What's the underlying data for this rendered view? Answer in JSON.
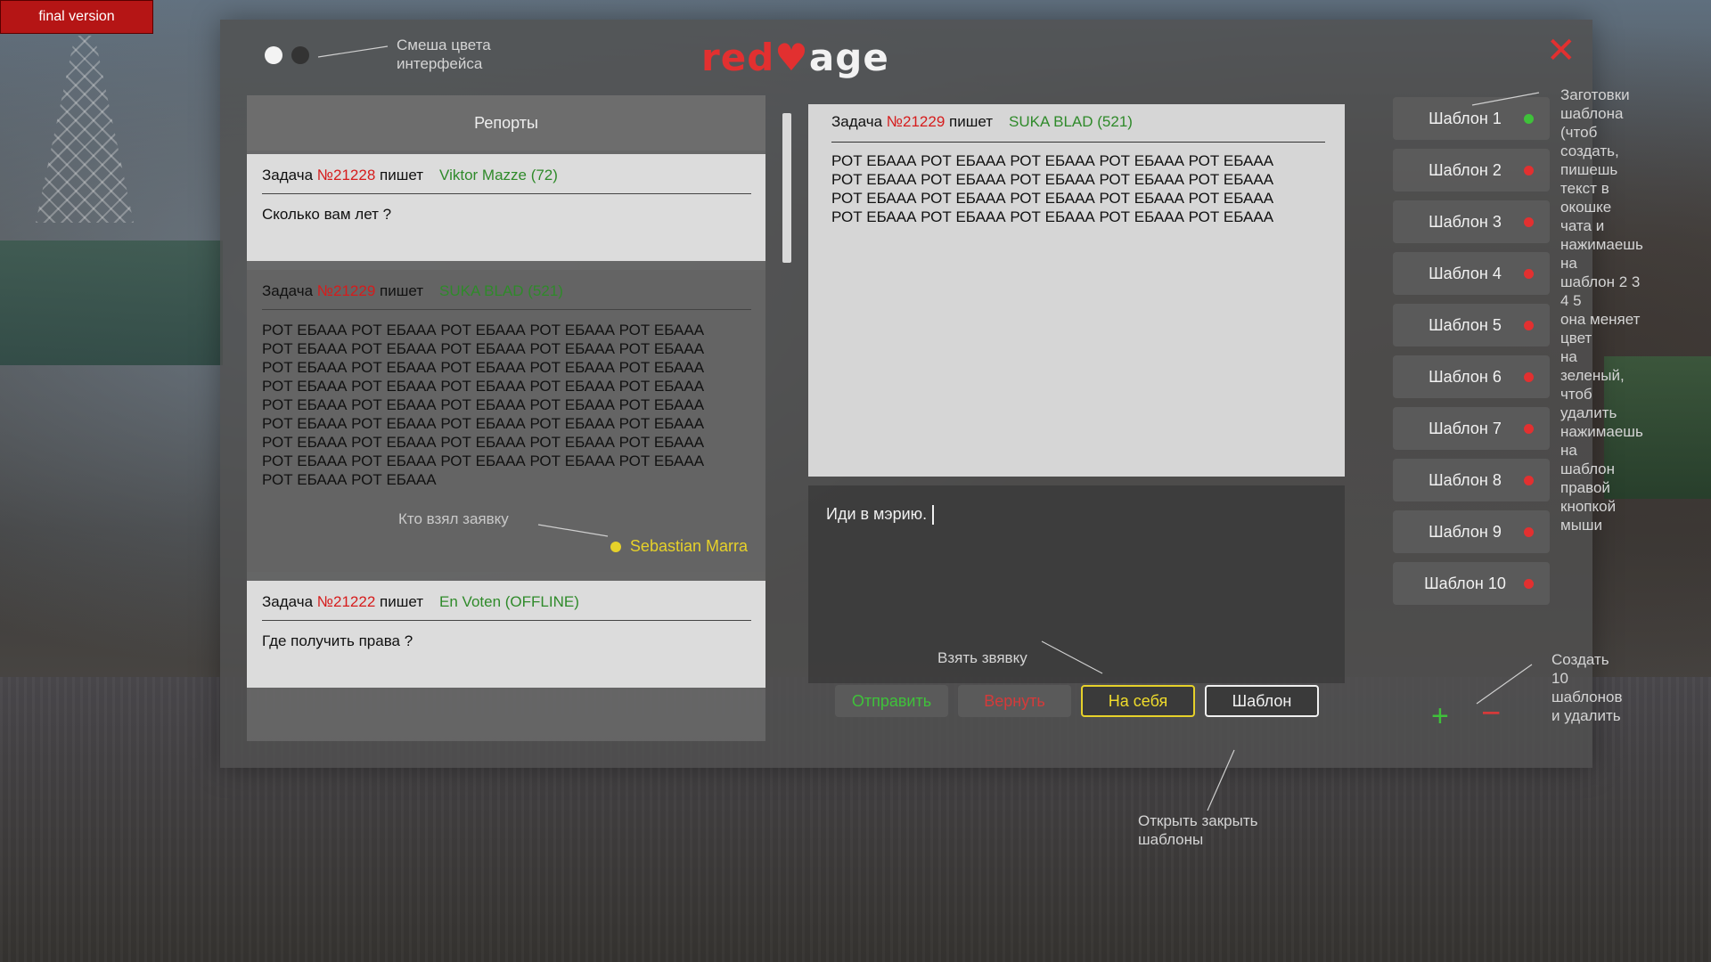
{
  "badge": "final version",
  "logo": {
    "part1": "red",
    "part2": "age"
  },
  "hints": {
    "color_swap": "Смеша цвета\nинтерфейса",
    "templates_info": "Заготовки\nшаблона\n(чтоб создать,\nпишешь текст в\nокошке чата и\nнажимаешь на\nшаблон 2 3 4 5\nона меняет цвет\nна зеленый, чтоб\nудалить\nнажимаешь на\nшаблон правой\nкнопкой мыши",
    "who_took": "Кто взял заявку",
    "take_request": "Взять звявку",
    "open_close_templates": "Открыть закрыть\nшаблоны",
    "create_templates": "Создать 10\nшаблонов\nи удалить"
  },
  "reports": {
    "title": "Репорты",
    "items": [
      {
        "prefix": "Задача ",
        "num": "№21228",
        "verb": " пишет",
        "author": "Viktor Mazze (72)",
        "text": "Сколько вам лет ?"
      },
      {
        "prefix": "Задача ",
        "num": "№21229",
        "verb": " пишет",
        "author": "SUKA BLAD (521)",
        "text": "РОТ ЕБААА РОТ ЕБААА РОТ ЕБААА РОТ ЕБААА РОТ ЕБААА\nРОТ ЕБААА РОТ ЕБААА РОТ ЕБААА РОТ ЕБААА РОТ ЕБААА\nРОТ ЕБААА РОТ ЕБААА РОТ ЕБААА РОТ ЕБААА РОТ ЕБААА\nРОТ ЕБААА РОТ ЕБААА РОТ ЕБААА РОТ ЕБААА РОТ ЕБААА\nРОТ ЕБААА РОТ ЕБААА РОТ ЕБААА РОТ ЕБААА РОТ ЕБААА\nРОТ ЕБААА РОТ ЕБААА РОТ ЕБААА РОТ ЕБААА РОТ ЕБААА\nРОТ ЕБААА РОТ ЕБААА РОТ ЕБААА РОТ ЕБААА РОТ ЕБААА\nРОТ ЕБААА РОТ ЕБААА РОТ ЕБААА РОТ ЕБААА РОТ ЕБААА\nРОТ ЕБААА РОТ ЕБААА",
        "taker": "Sebastian Marra"
      },
      {
        "prefix": "Задача ",
        "num": "№21222",
        "verb": " пишет",
        "author": "En Voten (OFFLINE)",
        "text": "Где получить права ?"
      }
    ]
  },
  "chat": {
    "prefix": "Задача ",
    "num": "№21229",
    "verb": " пишет",
    "author": "SUKA BLAD (521)",
    "text": "РОТ ЕБААА РОТ ЕБААА РОТ ЕБААА РОТ ЕБААА РОТ ЕБААА\nРОТ ЕБААА РОТ ЕБААА РОТ ЕБААА РОТ ЕБААА РОТ ЕБААА\nРОТ ЕБААА РОТ ЕБААА РОТ ЕБААА РОТ ЕБААА РОТ ЕБААА\nРОТ ЕБААА РОТ ЕБААА РОТ ЕБААА РОТ ЕБААА РОТ ЕБААА",
    "input_value": "Иди в мэрию."
  },
  "buttons": {
    "send": "Отправить",
    "return": "Вернуть",
    "self": "На себя",
    "template": "Шаблон"
  },
  "templates": [
    {
      "label": "Шаблон 1",
      "status": "green"
    },
    {
      "label": "Шаблон 2",
      "status": "red"
    },
    {
      "label": "Шаблон 3",
      "status": "red"
    },
    {
      "label": "Шаблон 4",
      "status": "red"
    },
    {
      "label": "Шаблон 5",
      "status": "red"
    },
    {
      "label": "Шаблон 6",
      "status": "red"
    },
    {
      "label": "Шаблон 7",
      "status": "red"
    },
    {
      "label": "Шаблон 8",
      "status": "red"
    },
    {
      "label": "Шаблон 9",
      "status": "red"
    },
    {
      "label": "Шаблон 10",
      "status": "red"
    }
  ],
  "controls": {
    "plus": "+",
    "minus": "−"
  },
  "colors": {
    "accent_red": "#e23030",
    "green": "#3fc13a",
    "yellow": "#e6d12a",
    "num_red": "#d61c1c",
    "author_green": "#2f8a2a"
  }
}
